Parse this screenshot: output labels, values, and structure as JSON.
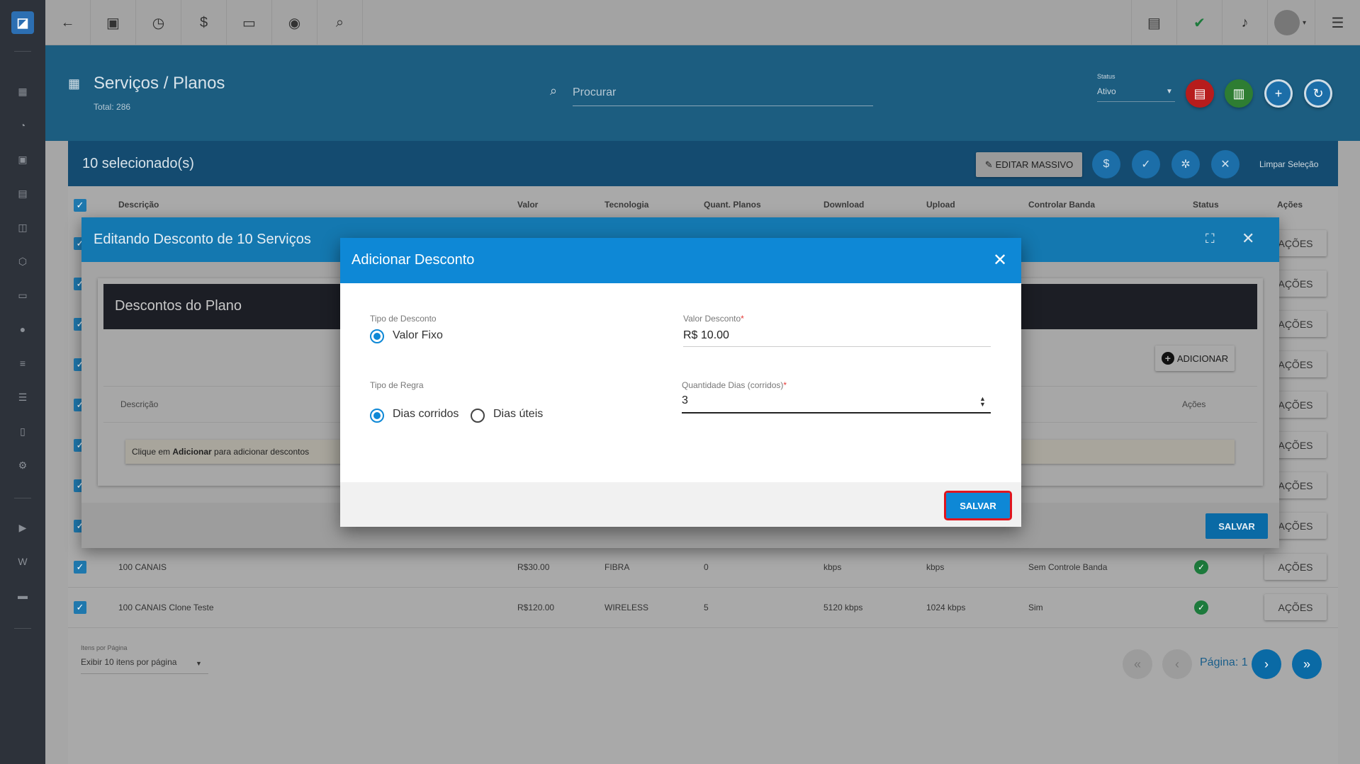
{
  "app": {
    "logo_icon": "app-logo-icon"
  },
  "header": {
    "title": "Serviços / Planos",
    "total": "Total: 286",
    "search_placeholder": "Procurar",
    "status_label": "Status",
    "status_value": "Ativo"
  },
  "selection": {
    "count": "10 selecionado(s)",
    "edit_mass": "EDITAR MASSIVO",
    "clear": "Limpar Seleção"
  },
  "table": {
    "headers": [
      "Descrição",
      "Valor",
      "Tecnologia",
      "Quant. Planos",
      "Download",
      "Upload",
      "Controlar Banda",
      "Status",
      "Ações"
    ],
    "action_label": "AÇÕES",
    "rows": [
      {
        "descricao": "100 CANAIS",
        "valor": "R$30.00",
        "tecnologia": "FIBRA",
        "quant": "0",
        "download": "kbps",
        "upload": "kbps",
        "banda": "Sem Controle Banda"
      },
      {
        "descricao": "100 CANAIS Clone Teste",
        "valor": "R$120.00",
        "tecnologia": "WIRELESS",
        "quant": "5",
        "download": "5120 kbps",
        "upload": "1024 kbps",
        "banda": "Sim"
      }
    ],
    "per_page_label": "Itens por Página",
    "per_page_value": "Exibir 10 itens por página",
    "page_label": "Página: 1"
  },
  "outer_dialog": {
    "title": "Editando Desconto de 10 Serviços",
    "card_title": "Descontos do Plano",
    "add_label": "ADICIONAR",
    "col_desc": "Descrição",
    "col_actions": "Ações",
    "hint_pre": "Clique em ",
    "hint_bold": "Adicionar",
    "hint_post": " para adicionar descontos",
    "save_label": "SALVAR"
  },
  "modal": {
    "title": "Adicionar Desconto",
    "tipo_desconto_label": "Tipo de Desconto",
    "tipo_desconto_option": "Valor Fixo",
    "valor_label": "Valor Desconto",
    "valor_value": "R$ 10.00",
    "tipo_regra_label": "Tipo de Regra",
    "regra_opt1": "Dias corridos",
    "regra_opt2": "Dias úteis",
    "qtd_label": "Quantidade Dias (corridos)",
    "qtd_value": "3",
    "required_mark": "*",
    "save_label": "SALVAR"
  },
  "colors": {
    "accent": "#0e88d6",
    "pdf": "#b71c1c",
    "excel": "#2e7d32",
    "selected_save_outline": "#e0161f"
  }
}
